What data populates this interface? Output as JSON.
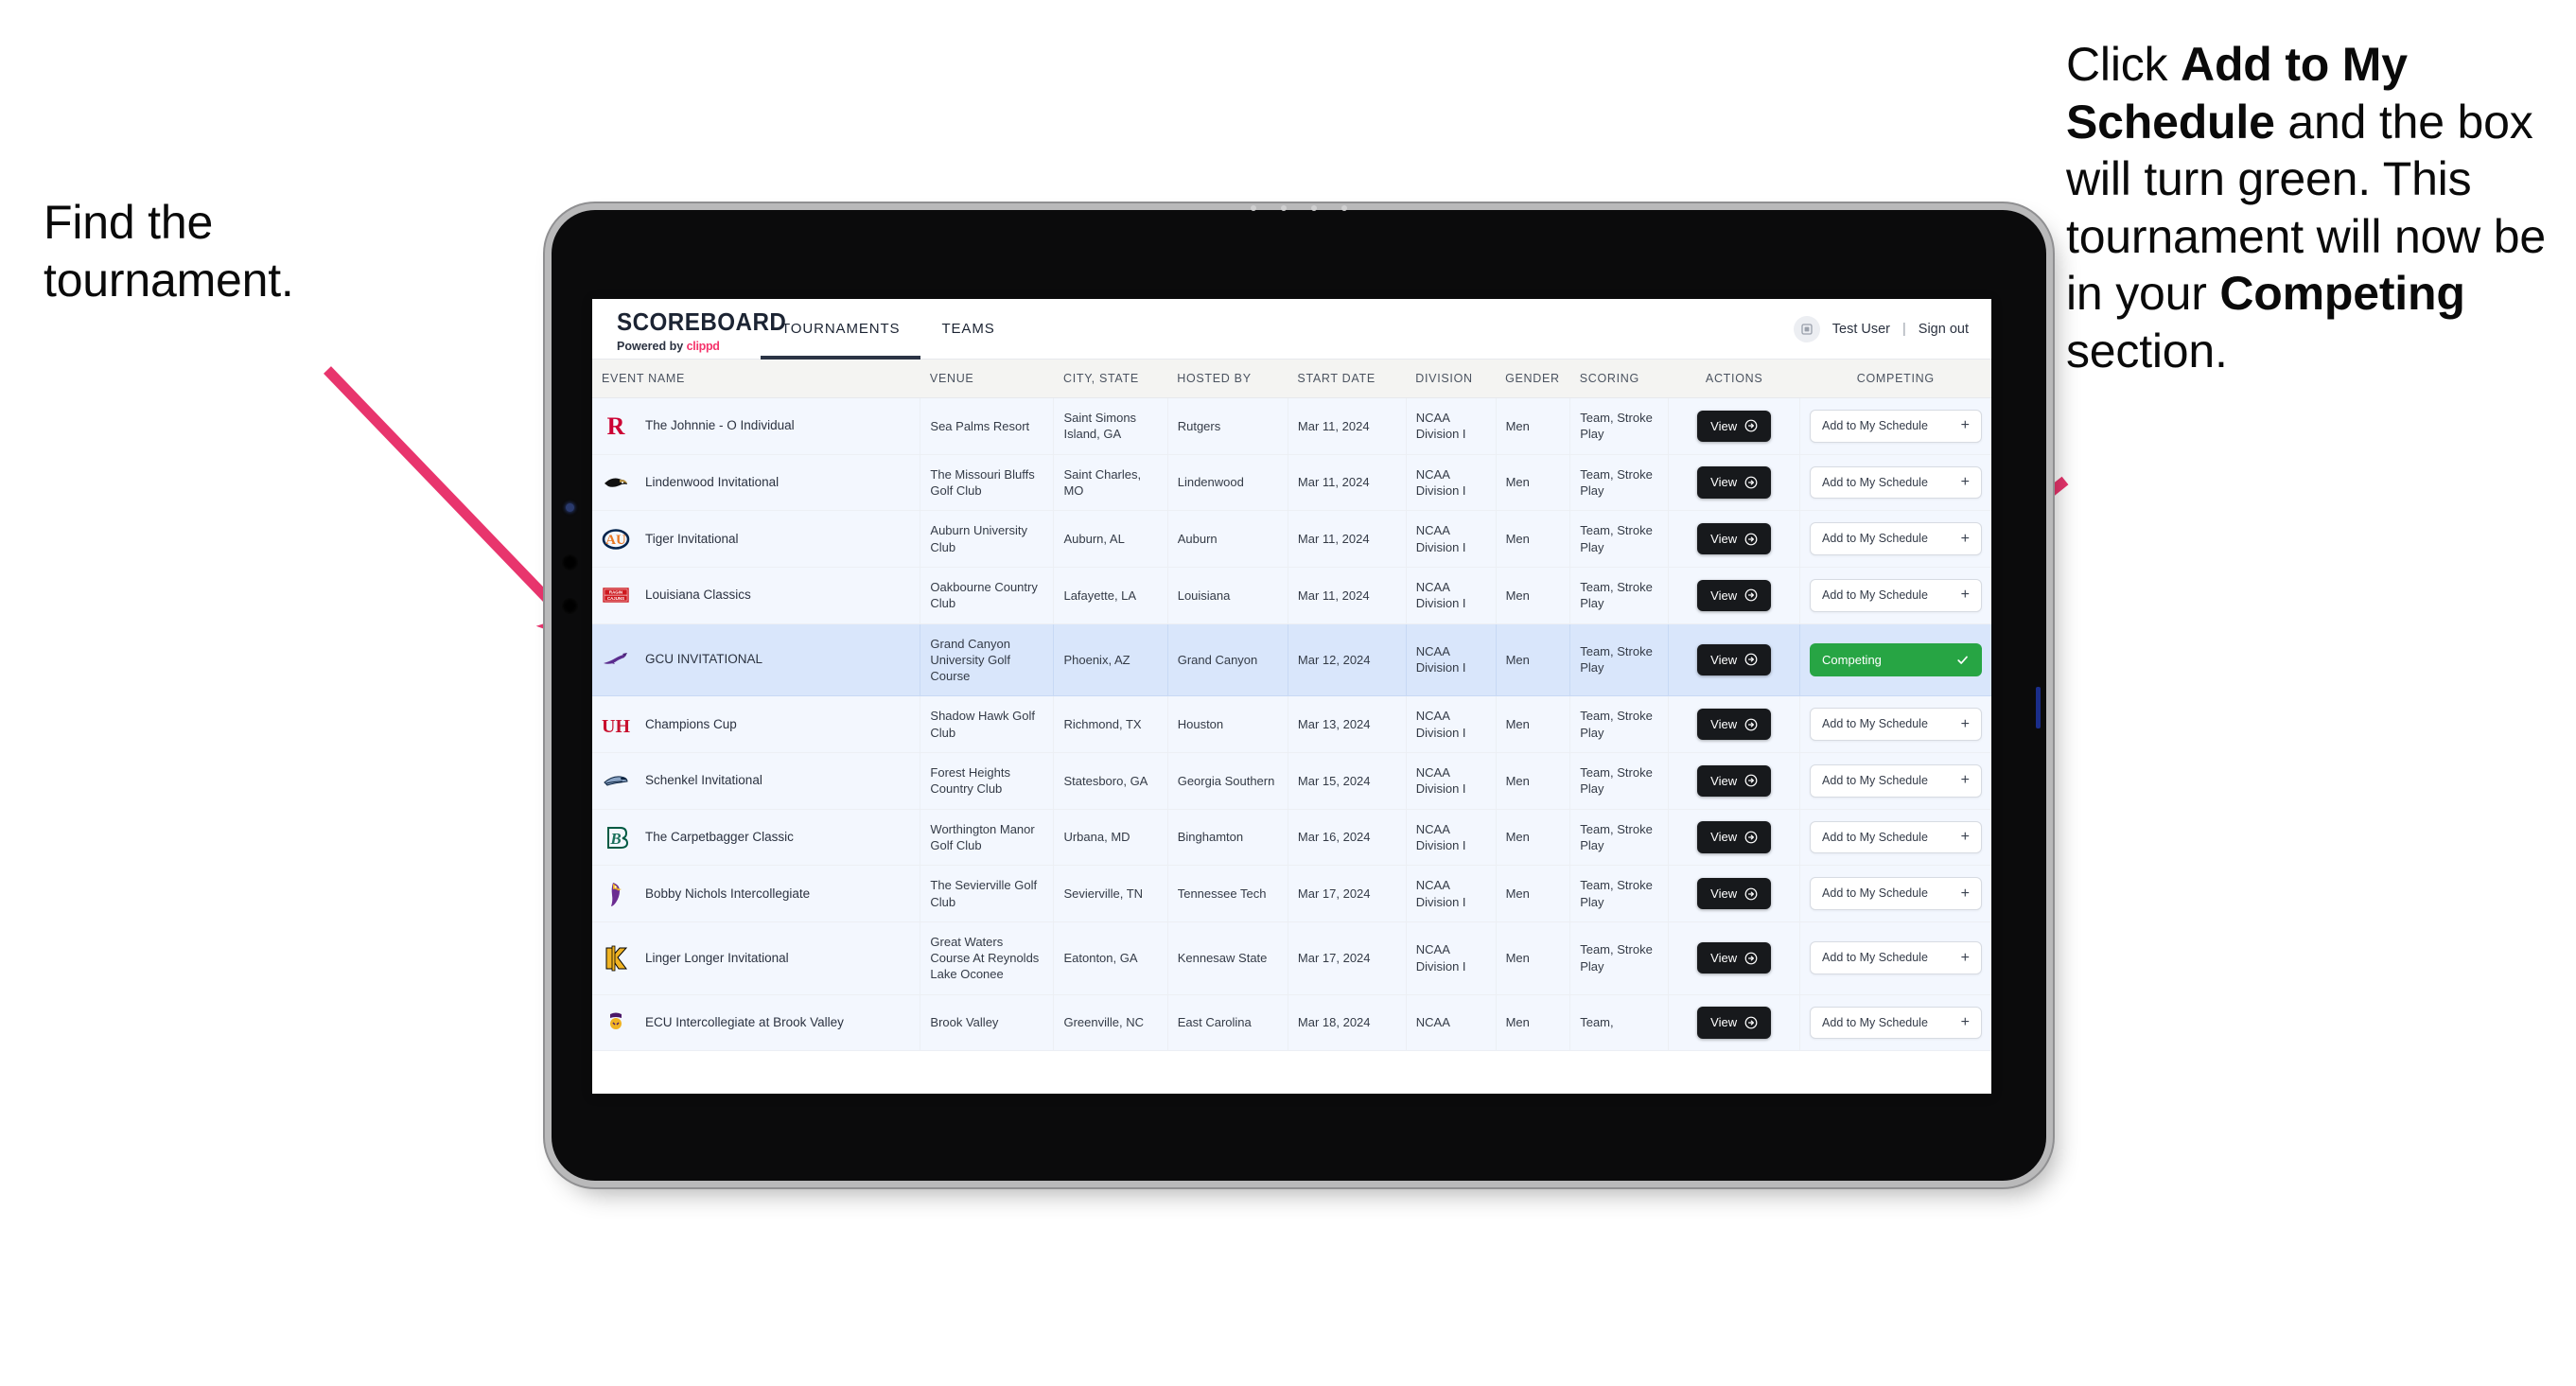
{
  "annotations": {
    "left": {
      "line1": "Find the",
      "line2": "tournament."
    },
    "right": {
      "seg1": "Click ",
      "bold1": "Add to My Schedule",
      "seg2": " and the box will turn green. This tournament will now be in your ",
      "bold2": "Competing",
      "seg3": " section."
    },
    "arrow_color": "#e8356d"
  },
  "app": {
    "brand": {
      "title": "SCOREBOARD",
      "powered_prefix": "Powered by ",
      "powered_name": "clippd"
    },
    "nav_tabs": [
      {
        "label": "TOURNAMENTS",
        "active": true
      },
      {
        "label": "TEAMS",
        "active": false
      }
    ],
    "user": {
      "name": "Test User",
      "separator": "|",
      "sign_out": "Sign out",
      "avatar_icon": "user-avatar-icon"
    },
    "table": {
      "columns": [
        "EVENT NAME",
        "VENUE",
        "CITY, STATE",
        "HOSTED BY",
        "START DATE",
        "DIVISION",
        "GENDER",
        "SCORING",
        "ACTIONS",
        "COMPETING"
      ],
      "action_label": "View",
      "add_label": "Add to My Schedule",
      "add_icon": "plus-icon",
      "view_icon": "arrow-circle-right-icon",
      "competing_label": "Competing",
      "competing_icon": "check-icon",
      "rows": [
        {
          "logo": "rutgers-r-logo",
          "event": "The Johnnie - O Individual",
          "venue": "Sea Palms Resort",
          "city": "Saint Simons Island, GA",
          "host": "Rutgers",
          "date": "Mar 11, 2024",
          "division": "NCAA Division I",
          "gender": "Men",
          "scoring": "Team, Stroke Play",
          "competing": false
        },
        {
          "logo": "lindenwood-lion-logo",
          "event": "Lindenwood Invitational",
          "venue": "The Missouri Bluffs Golf Club",
          "city": "Saint Charles, MO",
          "host": "Lindenwood",
          "date": "Mar 11, 2024",
          "division": "NCAA Division I",
          "gender": "Men",
          "scoring": "Team, Stroke Play",
          "competing": false
        },
        {
          "logo": "auburn-au-logo",
          "event": "Tiger Invitational",
          "venue": "Auburn University Club",
          "city": "Auburn, AL",
          "host": "Auburn",
          "date": "Mar 11, 2024",
          "division": "NCAA Division I",
          "gender": "Men",
          "scoring": "Team, Stroke Play",
          "competing": false
        },
        {
          "logo": "ragin-cajuns-logo",
          "event": "Louisiana Classics",
          "venue": "Oakbourne Country Club",
          "city": "Lafayette, LA",
          "host": "Louisiana",
          "date": "Mar 11, 2024",
          "division": "NCAA Division I",
          "gender": "Men",
          "scoring": "Team, Stroke Play",
          "competing": false
        },
        {
          "logo": "gcu-lope-logo",
          "event": "GCU INVITATIONAL",
          "venue": "Grand Canyon University Golf Course",
          "city": "Phoenix, AZ",
          "host": "Grand Canyon",
          "date": "Mar 12, 2024",
          "division": "NCAA Division I",
          "gender": "Men",
          "scoring": "Team, Stroke Play",
          "competing": true
        },
        {
          "logo": "houston-uh-logo",
          "event": "Champions Cup",
          "venue": "Shadow Hawk Golf Club",
          "city": "Richmond, TX",
          "host": "Houston",
          "date": "Mar 13, 2024",
          "division": "NCAA Division I",
          "gender": "Men",
          "scoring": "Team, Stroke Play",
          "competing": false
        },
        {
          "logo": "georgia-southern-eagle-logo",
          "event": "Schenkel Invitational",
          "venue": "Forest Heights Country Club",
          "city": "Statesboro, GA",
          "host": "Georgia Southern",
          "date": "Mar 15, 2024",
          "division": "NCAA Division I",
          "gender": "Men",
          "scoring": "Team, Stroke Play",
          "competing": false
        },
        {
          "logo": "binghamton-b-logo",
          "event": "The Carpetbagger Classic",
          "venue": "Worthington Manor Golf Club",
          "city": "Urbana, MD",
          "host": "Binghamton",
          "date": "Mar 16, 2024",
          "division": "NCAA Division I",
          "gender": "Men",
          "scoring": "Team, Stroke Play",
          "competing": false
        },
        {
          "logo": "tennessee-tech-eagle-logo",
          "event": "Bobby Nichols Intercollegiate",
          "venue": "The Sevierville Golf Club",
          "city": "Sevierville, TN",
          "host": "Tennessee Tech",
          "date": "Mar 17, 2024",
          "division": "NCAA Division I",
          "gender": "Men",
          "scoring": "Team, Stroke Play",
          "competing": false
        },
        {
          "logo": "kennesaw-state-ksu-logo",
          "event": "Linger Longer Invitational",
          "venue": "Great Waters Course At Reynolds Lake Oconee",
          "city": "Eatonton, GA",
          "host": "Kennesaw State",
          "date": "Mar 17, 2024",
          "division": "NCAA Division I",
          "gender": "Men",
          "scoring": "Team, Stroke Play",
          "competing": false
        },
        {
          "logo": "ecu-pirate-logo",
          "event": "ECU Intercollegiate at Brook Valley",
          "venue": "Brook Valley",
          "city": "Greenville, NC",
          "host": "East Carolina",
          "date": "Mar 18, 2024",
          "division": "NCAA",
          "gender": "Men",
          "scoring": "Team,",
          "competing": false,
          "clipped": true
        }
      ]
    }
  },
  "colors": {
    "accent_pink": "#e8356d",
    "green": "#27a544",
    "dark": "#17191c",
    "row_bg": "#f3f7fe",
    "row_highlight": "#d9e6fb",
    "header_bg": "#f4f4f2"
  }
}
